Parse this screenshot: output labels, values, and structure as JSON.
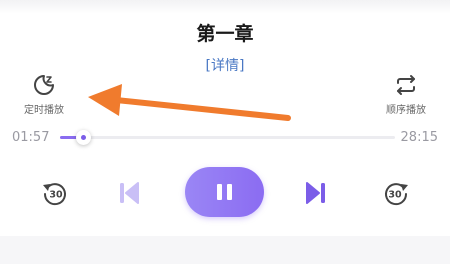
{
  "player": {
    "chapter_title": "第一章",
    "details_link": "[详情]",
    "timer_label": "定时播放",
    "order_label": "顺序播放",
    "current_time": "01:57",
    "total_time": "28:15",
    "progress": 0.07,
    "rewind_seconds": "30",
    "forward_seconds": "30",
    "state": "playing"
  },
  "colors": {
    "accent": "#8b6cf2",
    "annotation_arrow": "#f07b2d",
    "link": "#4a78c4"
  },
  "icons": {
    "timer": "moon-sleep-icon",
    "order": "repeat-icon",
    "rewind": "rewind-30-icon",
    "previous": "previous-track-icon",
    "pause": "pause-icon",
    "next": "next-track-icon",
    "forward": "forward-30-icon",
    "annotation": "orange-arrow"
  }
}
